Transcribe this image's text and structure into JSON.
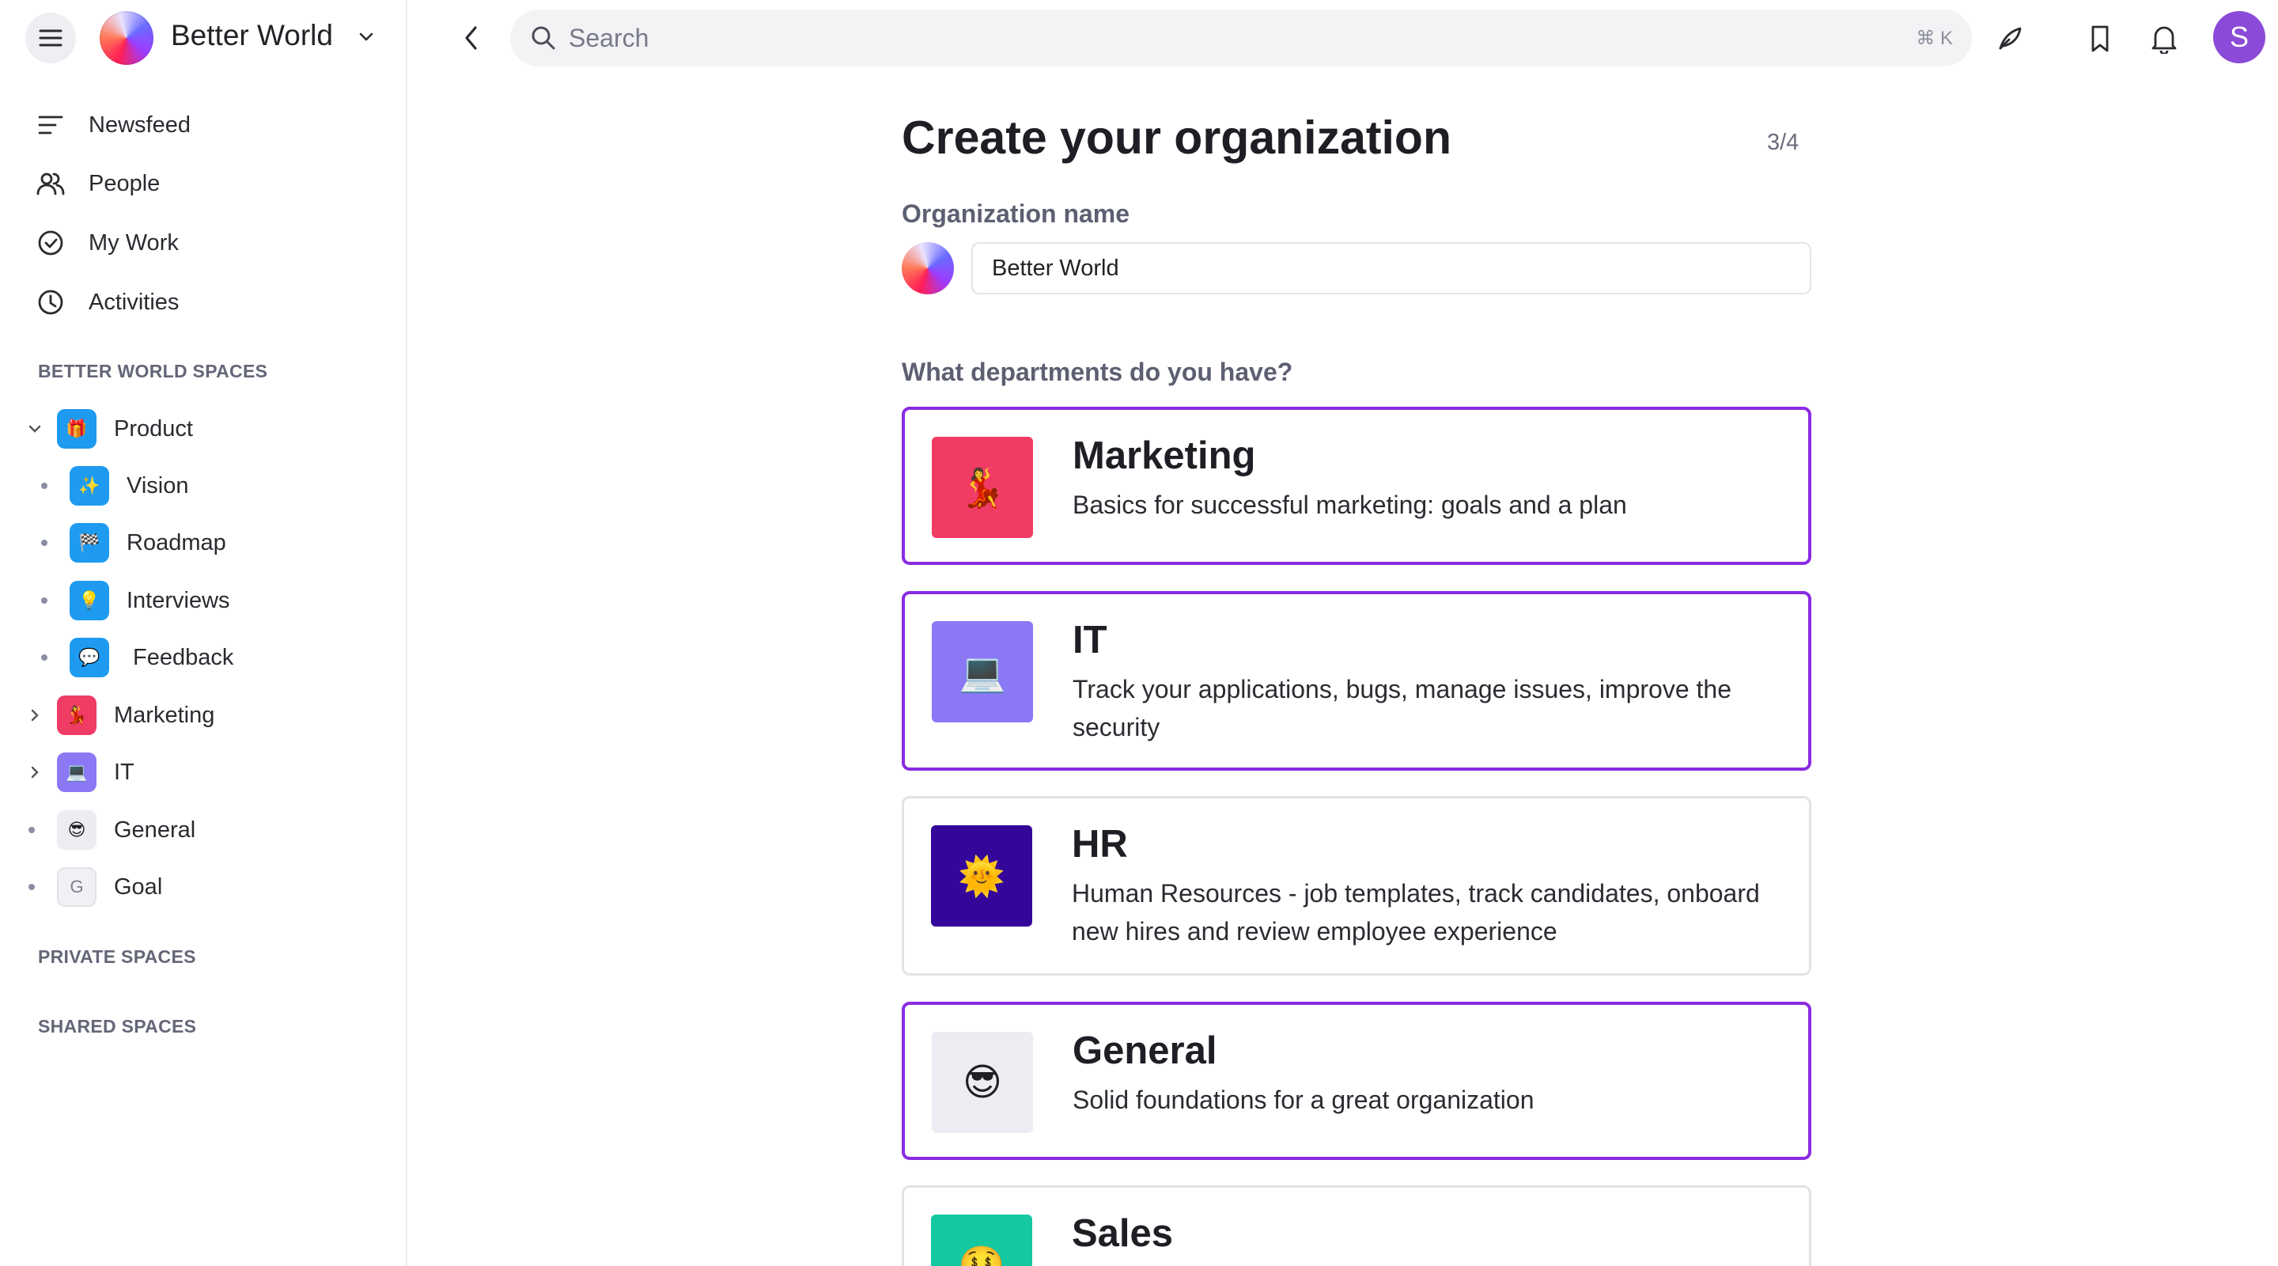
{
  "sidebar": {
    "org_name": "Better World",
    "nav": [
      {
        "label": "Newsfeed",
        "icon": "newsfeed-icon"
      },
      {
        "label": "People",
        "icon": "people-icon"
      },
      {
        "label": "My Work",
        "icon": "check-circle-icon"
      },
      {
        "label": "Activities",
        "icon": "clock-icon"
      }
    ],
    "spaces_title": "BETTER WORLD SPACES",
    "spaces": [
      {
        "label": "Product",
        "emoji": "🎁",
        "color": "#1e9bf0"
      },
      {
        "label": "Vision",
        "emoji": "✨",
        "color": "#1e9bf0"
      },
      {
        "label": "Roadmap",
        "emoji": "🏁",
        "color": "#1e9bf0"
      },
      {
        "label": "Interviews",
        "emoji": "💡",
        "color": "#1e9bf0"
      },
      {
        "label": "Feedback",
        "emoji": "💬",
        "color": "#1e9bf0"
      },
      {
        "label": "Marketing",
        "emoji": "💃",
        "color": "#f03c64"
      },
      {
        "label": "IT",
        "emoji": "💻",
        "color": "#8a78f5"
      },
      {
        "label": "General",
        "emoji": "😎",
        "color": "#ececf3"
      },
      {
        "label": "Goal",
        "emoji": "G",
        "color": "#f0f0f5"
      }
    ],
    "private_title": "PRIVATE SPACES",
    "shared_title": "SHARED SPACES"
  },
  "topbar": {
    "search_placeholder": "Search",
    "search_shortcut": "⌘ K",
    "user_initial": "S"
  },
  "main": {
    "title": "Create your organization",
    "step": "3/4",
    "org_label": "Organization name",
    "org_value": "Better World",
    "question": "What departments do you have?",
    "departments": [
      {
        "title": "Marketing",
        "desc": "Basics for successful marketing: goals and a plan",
        "emoji": "💃",
        "color": "#f03c64",
        "selected": true
      },
      {
        "title": "IT",
        "desc": "Track your applications, bugs, manage issues, improve the security",
        "emoji": "💻",
        "color": "#8a78f5",
        "selected": true
      },
      {
        "title": "HR",
        "desc": "Human Resources - job templates, track candidates, onboard new hires and review employee experience",
        "emoji": "🌞",
        "color": "#34069a",
        "selected": false
      },
      {
        "title": "General",
        "desc": "Solid foundations for a great organization",
        "emoji": "😎",
        "color": "#ececf3",
        "selected": true
      },
      {
        "title": "Sales",
        "desc": "",
        "emoji": "🤑",
        "color": "#14c8a0",
        "selected": false
      }
    ]
  }
}
